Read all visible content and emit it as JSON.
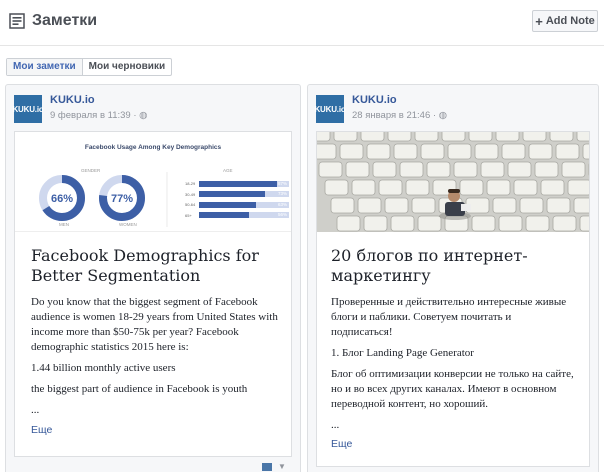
{
  "header": {
    "title": "Заметки",
    "add_button_label": "Add Note"
  },
  "tabs": [
    {
      "label": "Мои заметки",
      "active": true
    },
    {
      "label": "Мои черновики",
      "active": false
    }
  ],
  "posts": [
    {
      "avatar_text": "KUKU.io",
      "author": "KUKU.io",
      "date": "9 февраля в 11:39 · ",
      "image": {
        "title": "Facebook Usage Among Key Demographics",
        "gender_label": "GENDER",
        "age_label": "AGE",
        "donuts": [
          {
            "value": "66%",
            "label": "MEN",
            "fraction": 0.66
          },
          {
            "value": "77%",
            "label": "WOMEN",
            "fraction": 0.77
          }
        ],
        "bars": [
          {
            "label": "18-29",
            "value": "87%",
            "fraction": 0.87
          },
          {
            "label": "30-49",
            "value": "73%",
            "fraction": 0.73
          },
          {
            "label": "50-64",
            "value": "63%",
            "fraction": 0.63
          },
          {
            "label": "65+",
            "value": "56%",
            "fraction": 0.56
          }
        ]
      },
      "title": "Facebook Demographics for Better Segmentation",
      "paragraphs": [
        "Do you know that the biggest segment of Facebook audience is women 18-29 years from United States with income more than $50-75k per year? Facebook demographic statistics 2015 here is:",
        "1.44 billion monthly active users",
        "the biggest part of audience in Facebook is youth",
        "..."
      ],
      "more_label": "Еще"
    },
    {
      "avatar_text": "KUKU.io",
      "author": "KUKU.io",
      "date": "28 января в 21:46 · ",
      "title": "20 блогов по интернет-маркетингу",
      "paragraphs": [
        "Проверенные и действительно интересные живые блоги и паблики. Советуем почитать и подписаться!",
        "1. Блог Landing Page Generator",
        "Блог об оптимизации конверсии не только на сайте, но и во всех других каналах. Имеют в основном переводной контент, но хороший.",
        "..."
      ],
      "more_label": "Еще"
    }
  ],
  "colors": {
    "link": "#365899",
    "brand_blue": "#2f6ea5",
    "chart_blue": "#3d5fa6"
  }
}
